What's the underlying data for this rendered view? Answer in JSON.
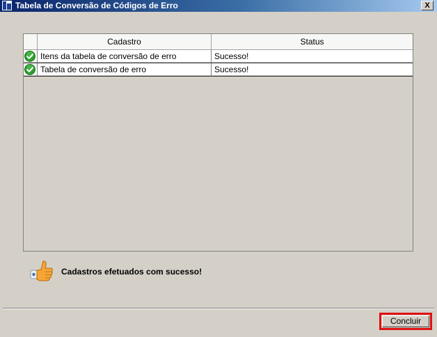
{
  "window": {
    "title": "Tabela de Conversão de Códigos de Erro",
    "close_label": "X"
  },
  "grid": {
    "columns": [
      "",
      "Cadastro",
      "Status"
    ],
    "rows": [
      {
        "cadastro": "Itens da tabela de conversão de erro",
        "status": "Sucesso!",
        "icon": "success-check-icon"
      },
      {
        "cadastro": "Tabela de conversão de erro",
        "status": "Sucesso!",
        "icon": "success-check-icon"
      }
    ]
  },
  "message": {
    "text": "Cadastros efetuados com sucesso!",
    "icon": "thumbs-up-icon"
  },
  "buttons": {
    "concluir_label": "Concluir"
  },
  "colors": {
    "success": "#2e9e2e",
    "highlight": "#e01010",
    "title_bar": "#0a246a"
  }
}
